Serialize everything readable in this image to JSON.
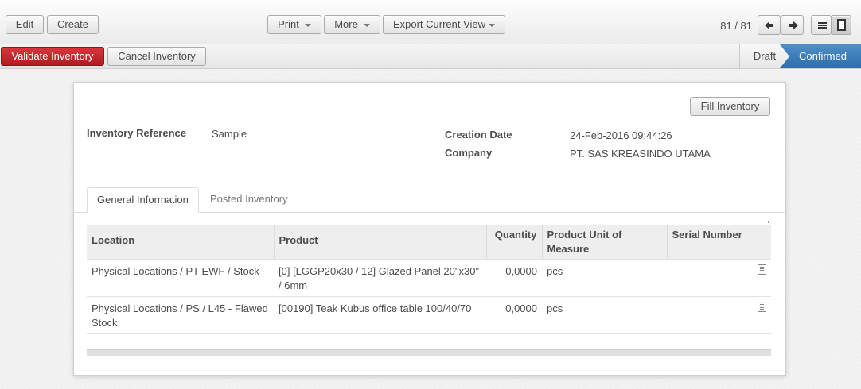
{
  "toolbar": {
    "edit_label": "Edit",
    "create_label": "Create",
    "print_label": "Print",
    "more_label": "More",
    "export_label": "Export Current View",
    "pager_text": "81 / 81"
  },
  "statusbar": {
    "validate_label": "Validate Inventory",
    "cancel_label": "Cancel Inventory",
    "stages": [
      "Draft",
      "Confirmed"
    ],
    "active_stage": "Confirmed"
  },
  "form": {
    "fill_label": "Fill Inventory",
    "inventory_reference_label": "Inventory Reference",
    "inventory_reference_value": "Sample",
    "creation_date_label": "Creation Date",
    "creation_date_value": "24-Feb-2016 09:44:26",
    "company_label": "Company",
    "company_value": "PT. SAS KREASINDO UTAMA"
  },
  "tabs": [
    {
      "label": "General Information",
      "active": true
    },
    {
      "label": "Posted Inventory",
      "active": false
    }
  ],
  "table": {
    "columns": [
      "Location",
      "Product",
      "Quantity",
      "Product Unit of Measure",
      "Serial Number"
    ],
    "rows": [
      {
        "location": "Physical Locations / PT EWF / Stock",
        "product": "[0] [LGGP20x30 / 12] Glazed Panel 20\"x30\" / 6mm",
        "quantity": "0,0000",
        "uom": "pcs",
        "serial": ""
      },
      {
        "location": "Physical Locations / PS / L45 - Flawed Stock",
        "product": "[00190] Teak Kubus office table 100/40/70",
        "quantity": "0,0000",
        "uom": "pcs",
        "serial": ""
      }
    ]
  },
  "colors": {
    "primary_button": "#c9282d",
    "active_stage": "#3a7dbd"
  }
}
